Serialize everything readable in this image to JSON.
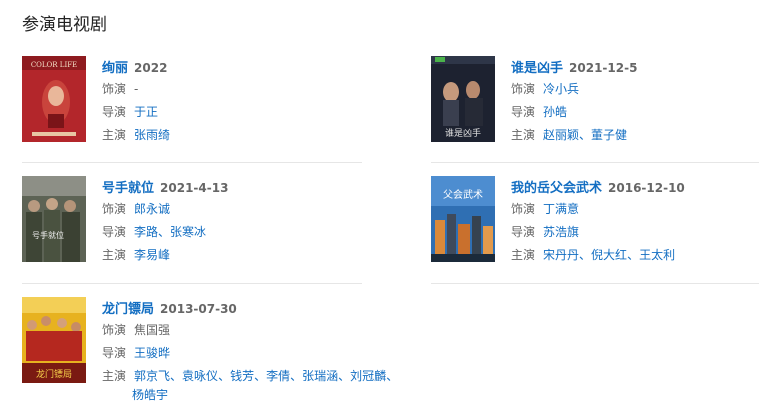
{
  "section_title": "参演电视剧",
  "labels": {
    "role": "饰演",
    "director": "导演",
    "star": "主演"
  },
  "works": [
    {
      "title": "绚丽",
      "date": "2022",
      "role": "-",
      "role_linked": false,
      "director": [
        "于正"
      ],
      "star": [
        "张雨绮"
      ],
      "poster": "red-magazine-poster"
    },
    {
      "title": "谁是凶手",
      "date": "2021-12-5",
      "role": "冷小兵",
      "role_linked": true,
      "director": [
        "孙皓"
      ],
      "star": [
        "赵丽颖",
        "董子健"
      ],
      "poster": "dark-drama-poster"
    },
    {
      "title": "号手就位",
      "date": "2021-4-13",
      "role": "郎永诚",
      "role_linked": true,
      "director": [
        "李路",
        "张寒冰"
      ],
      "star": [
        "李易峰"
      ],
      "poster": "military-group-poster"
    },
    {
      "title": "我的岳父会武术",
      "date": "2016-12-10",
      "role": "丁满意",
      "role_linked": true,
      "director": [
        "苏浩旗"
      ],
      "star": [
        "宋丹丹",
        "倪大红",
        "王太利"
      ],
      "poster": "city-skyline-poster"
    },
    {
      "title": "龙门镖局",
      "date": "2013-07-30",
      "role": "焦国强",
      "role_linked": false,
      "director": [
        "王骏晔"
      ],
      "star": [
        "郭京飞",
        "袁咏仪",
        "钱芳",
        "李倩",
        "张瑞涵",
        "刘冠麟",
        "杨皓宇"
      ],
      "poster": "yellow-ensemble-poster"
    }
  ],
  "poster_colors": {
    "red": "#b3262b",
    "dark": "#1d2230",
    "military": "#5d6355",
    "sky": "#2f6fb3",
    "yellow": "#e7b21f"
  }
}
